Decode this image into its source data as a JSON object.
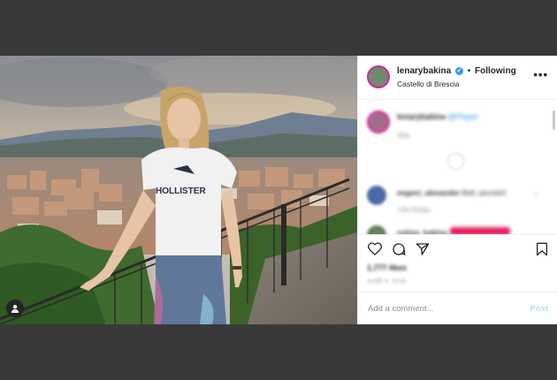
{
  "post": {
    "username": "lenarybakina",
    "separator": "•",
    "follow_label": "Following",
    "location": "Castello di Brescia",
    "more_icon": "more-horizontal-icon",
    "photo_alt": "Photo of a girl in a white Hollister t-shirt on a terrace overlooking a city",
    "shirt_text": "HOLLISTER"
  },
  "comments": [
    {
      "user": "lenarybakina",
      "text": "@Player",
      "meta": "45w"
    },
    {
      "user": "evgeni_alexander",
      "text": "Bell, piccolo!!",
      "meta": "13w   Reply"
    },
    {
      "user": "ustina_bakina",
      "text": ""
    }
  ],
  "actions": {
    "like_icon": "heart-icon",
    "comment_icon": "comment-icon",
    "share_icon": "share-icon",
    "save_icon": "bookmark-icon"
  },
  "likes": "1,777 likes",
  "date": "JUNE 6, 2018",
  "add_comment": {
    "placeholder": "Add a comment...",
    "post_label": "Post"
  },
  "colors": {
    "background": "#393939",
    "verified": "#3897f0",
    "post_disabled": "#b2dffc"
  }
}
